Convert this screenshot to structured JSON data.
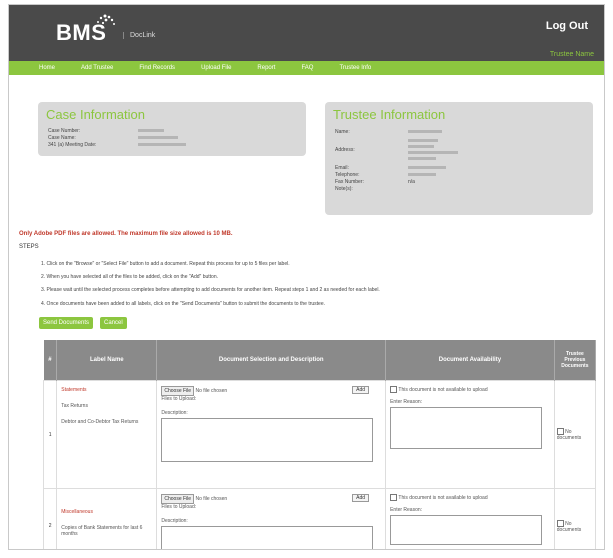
{
  "header": {
    "logo_text": "BMS",
    "logo_sub": "DocLink",
    "logout": "Log Out",
    "trustee_link": "Trustee Name"
  },
  "nav": [
    "Home",
    "Add Trustee",
    "Find Records",
    "Upload File",
    "Report",
    "FAQ",
    "Trustee Info"
  ],
  "case_info": {
    "title": "Case Information",
    "fields": [
      {
        "label": "Case Number:"
      },
      {
        "label": "Case Name:"
      },
      {
        "label": "341 (a) Meeting Date:"
      }
    ]
  },
  "trustee_info": {
    "title": "Trustee Information",
    "fields": [
      {
        "label": "Name:"
      },
      {
        "label": "Address:"
      },
      {
        "label": "Email:"
      },
      {
        "label": "Telephone:"
      },
      {
        "label": "Fax Number:",
        "value": "n/a"
      },
      {
        "label": "Note(s):"
      }
    ]
  },
  "warning": "Only Adobe PDF files are allowed. The maximum file size allowed is 10 MB.",
  "steps_label": "STEPS",
  "steps": [
    "1. Click on the \"Browse\" or \"Select File\" button to add a document. Repeat this process for up to 5 files per label.",
    "2. When you have selected all of the files to be added, click on the \"Add\" button.",
    "3. Please wait until the selected process completes before attempting to add documents for another item. Repeat steps 1 and 2 as needed for each label.",
    "4. Once documents have been added to all labels, click on the \"Send Documents\" button to submit the documents to the trustee."
  ],
  "buttons": {
    "send": "Send Documents",
    "cancel": "Cancel"
  },
  "table": {
    "headers": [
      "#",
      "Label Name",
      "Document Selection and Description",
      "Document Availability",
      "Trustee Previous Documents"
    ],
    "rows": [
      {
        "num": "1",
        "red_label": "Statements",
        "sub_label": "Tax Returns",
        "desc": "Debtor and Co-Debtor Tax Returns",
        "choose": "Choose File",
        "no_file": "No file chosen",
        "add": "Add",
        "files_to_upload": "Files to Upload:",
        "description_label": "Description:",
        "na_check": "This document is not available to upload",
        "reason_label": "Enter Reason:",
        "prev": "No documents"
      },
      {
        "num": "2",
        "red_label": "Miscellaneous",
        "sub_label": "",
        "desc": "Copies of Bank Statements for last 6 months",
        "choose": "Choose File",
        "no_file": "No file chosen",
        "add": "Add",
        "files_to_upload": "Files to Upload:",
        "description_label": "Description:",
        "na_check": "This document is not available to upload",
        "reason_label": "Enter Reason:",
        "prev": "No documents"
      }
    ]
  }
}
